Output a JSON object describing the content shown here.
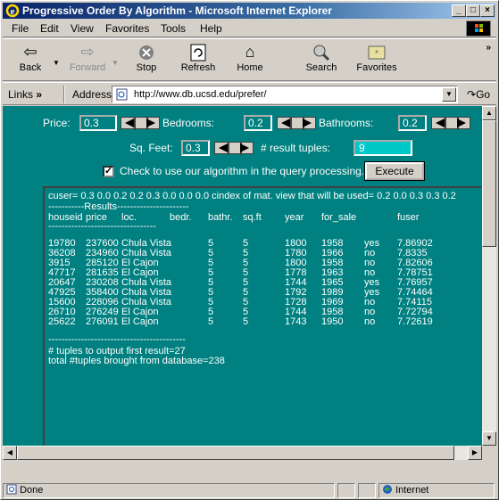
{
  "window": {
    "title": "Progressive Order By Algorithm - Microsoft Internet Explorer"
  },
  "menu": {
    "items": [
      "File",
      "Edit",
      "View",
      "Favorites",
      "Tools",
      "Help"
    ]
  },
  "toolbar": {
    "back": "Back",
    "forward": "Forward",
    "stop": "Stop",
    "refresh": "Refresh",
    "home": "Home",
    "search": "Search",
    "favorites": "Favorites",
    "more": "»"
  },
  "address": {
    "links": "Links",
    "links_chevron": "»",
    "label": "Address",
    "url": "http://www.db.ucsd.edu/prefer/",
    "go": "Go"
  },
  "form": {
    "price_label": "Price:",
    "price_value": "0.3",
    "bedrooms_label": "Bedrooms:",
    "bedrooms_value": "0.2",
    "bathrooms_label": "Bathrooms:",
    "bathrooms_value": "0.2",
    "sqfeet_label": "Sq. Feet:",
    "sqfeet_value": "0.3",
    "tuples_label": "# result tuples:",
    "tuples_value": "9",
    "algorithm_checkbox_label": "Check to use our algorithm in the query processing.",
    "algorithm_checked": true,
    "execute_label": "Execute"
  },
  "results": {
    "cuser_line": "cuser= 0.3 0.0 0.2 0.2 0.3 0.0 0.0 0.0    cindex of mat. view that will be used= 0.2 0.0 0.3 0.3 0.2",
    "results_header": "-----------Results----------------------",
    "columns": [
      "houseid",
      "price",
      "loc.",
      "bedr.",
      "bathr.",
      "sq.ft",
      "year",
      "for_sale",
      "fuser"
    ],
    "columns_separator": "---------------------------------",
    "rows": [
      [
        "19780",
        "237600",
        "Chula Vista",
        "5",
        "5",
        "1800",
        "1958",
        "yes",
        "7.86902"
      ],
      [
        "36208",
        "234960",
        "Chula Vista",
        "5",
        "5",
        "1780",
        "1966",
        "no",
        "7.8335"
      ],
      [
        "3915",
        "285120",
        "El Cajon",
        "5",
        "5",
        "1800",
        "1958",
        "no",
        "7.82606"
      ],
      [
        "47717",
        "281635",
        "El Cajon",
        "5",
        "5",
        "1778",
        "1963",
        "no",
        "7.78751"
      ],
      [
        "20647",
        "230208",
        "Chula Vista",
        "5",
        "5",
        "1744",
        "1965",
        "yes",
        "7.76957"
      ],
      [
        "47925",
        "358400",
        "Chula Vista",
        "5",
        "5",
        "1792",
        "1989",
        "yes",
        "7.74464"
      ],
      [
        "15600",
        "228096",
        "Chula Vista",
        "5",
        "5",
        "1728",
        "1969",
        "no",
        "7.74115"
      ],
      [
        "26710",
        "276249",
        "El Cajon",
        "5",
        "5",
        "1744",
        "1958",
        "no",
        "7.72794"
      ],
      [
        "25622",
        "276091",
        "El Cajon",
        "5",
        "5",
        "1743",
        "1950",
        "no",
        "7.72619"
      ]
    ],
    "footer_separator": "------------------------------------------",
    "tuples_first": "# tuples to output first result=27",
    "tuples_total": "total #tuples brought from database=238"
  },
  "status": {
    "text": "Done",
    "zone": "Internet"
  }
}
